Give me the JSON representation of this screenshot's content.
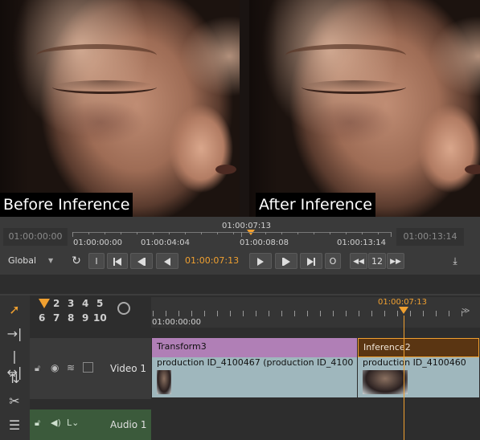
{
  "viewer": {
    "before_label": "Before Inference",
    "after_label": "After Inference"
  },
  "transport": {
    "timecode_in": "01:00:00:00",
    "timecode_out": "01:00:13:14",
    "playhead_marker": "01:00:07:13",
    "ruler_labels": [
      "01:00:00:00",
      "01:00:04:04",
      "01:00:08:08",
      "01:00:13:14"
    ],
    "view_mode": "Global",
    "buttons": {
      "in_point": "I",
      "out_point": "O",
      "current_time": "01:00:07:13",
      "frame_step": "12"
    }
  },
  "timeline": {
    "layer_numbers": [
      "2",
      "3",
      "4",
      "5",
      "6",
      "7",
      "8",
      "9",
      "10"
    ],
    "playhead_time": "01:00:07:13",
    "ruler_start": "01:00:00:00",
    "tracks": [
      {
        "name": "Video 1",
        "clips": [
          {
            "effect": "Transform3",
            "source": "production ID_4100467 (production ID_4100",
            "color": "#b07fb6"
          },
          {
            "effect": "Inference2",
            "source": "production ID_4100460",
            "color": "#5a3512"
          }
        ]
      },
      {
        "name": "Audio 1",
        "clips": []
      }
    ]
  },
  "colors": {
    "playhead": "#f0a030",
    "video_track": "#3a3a3a",
    "audio_track": "#3b5a3b"
  }
}
